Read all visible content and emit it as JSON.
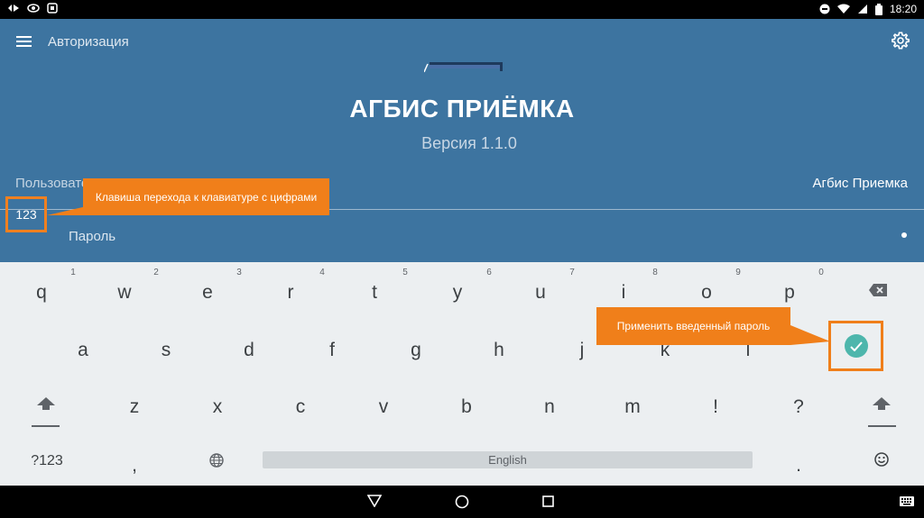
{
  "status_bar": {
    "time": "18:20",
    "left_icons": [
      "network-icon",
      "eye-icon",
      "app-icon"
    ],
    "right_icons": [
      "do-not-disturb-icon",
      "wifi-icon",
      "signal-icon",
      "battery-icon"
    ]
  },
  "toolbar": {
    "title": "Авторизация"
  },
  "app": {
    "title": "АГБИС ПРИЁМКА",
    "version": "Версия 1.1.0"
  },
  "form": {
    "user_label": "Пользователь",
    "user_value": "Агбис Приемка",
    "password_label": "Пароль"
  },
  "annotations": {
    "numeric_key_label": "123",
    "numeric_key_callout": "Клавиша перехода к клавиатуре с цифрами",
    "enter_callout": "Применить введенный пароль"
  },
  "keyboard": {
    "row1": [
      "q",
      "w",
      "e",
      "r",
      "t",
      "y",
      "u",
      "i",
      "o",
      "p"
    ],
    "row1_hints": [
      "1",
      "2",
      "3",
      "4",
      "5",
      "6",
      "7",
      "8",
      "9",
      "0"
    ],
    "row2": [
      "a",
      "s",
      "d",
      "f",
      "g",
      "h",
      "j",
      "k",
      "l"
    ],
    "row3": [
      "z",
      "x",
      "c",
      "v",
      "b",
      "n",
      "m",
      "!",
      "?"
    ],
    "symbols_key": "?123",
    "comma_key": ",",
    "period_key": ".",
    "space_label": "English"
  },
  "colors": {
    "app_background": "#3d74a0",
    "keyboard_background": "#eceff1",
    "accent": "#4db6ac",
    "callout": "#f07f1a"
  }
}
